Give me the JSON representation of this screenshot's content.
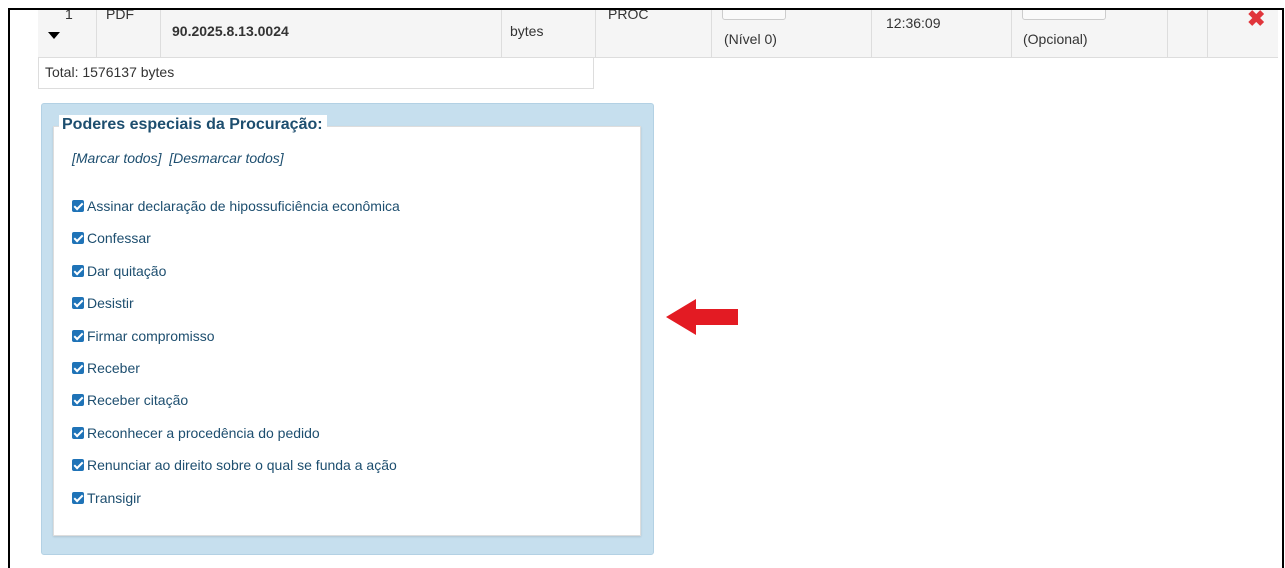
{
  "doc_row": {
    "seq": "1",
    "file_type": "PDF",
    "doc_name": "90.2025.8.13.0024",
    "bytes_label": "bytes",
    "doc_kind": "PROC",
    "level": "(Nível 0)",
    "time": "12:36:09",
    "optional": "(Opcional)",
    "delete_glyph": "✖"
  },
  "total": "Total: 1576137 bytes",
  "powers": {
    "title": "Poderes especiais da Procuração:",
    "mark_all": "[Marcar todos]",
    "unmark_all": "[Desmarcar todos]",
    "options": [
      {
        "label": "Assinar declaração de hipossuficiência econômica",
        "checked": true
      },
      {
        "label": "Confessar",
        "checked": true
      },
      {
        "label": "Dar quitação",
        "checked": true
      },
      {
        "label": "Desistir",
        "checked": true
      },
      {
        "label": "Firmar compromisso",
        "checked": true
      },
      {
        "label": "Receber",
        "checked": true
      },
      {
        "label": "Receber citação",
        "checked": true
      },
      {
        "label": "Reconhecer a procedência do pedido",
        "checked": true
      },
      {
        "label": "Renunciar ao direito sobre o qual se funda a ação",
        "checked": true
      },
      {
        "label": "Transigir",
        "checked": true
      }
    ]
  },
  "colors": {
    "panel_bg": "#c6dfee",
    "accent_text": "#1d4e6f",
    "checkbox": "#1f73b7",
    "arrow": "#e31b23",
    "delete": "#e0353b"
  },
  "icons": {
    "expand": "caret-down-icon",
    "delete": "delete-x-icon",
    "checkbox": "checkbox-checked-icon",
    "pointer": "red-left-arrow-icon"
  }
}
